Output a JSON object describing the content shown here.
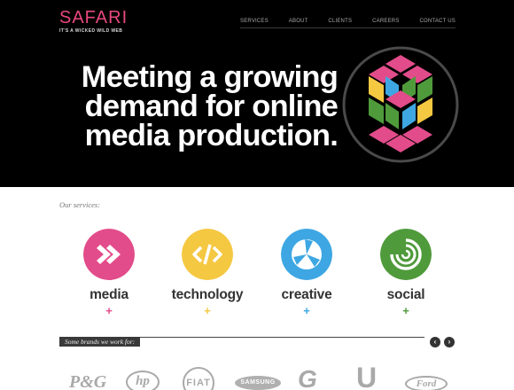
{
  "logo": {
    "word": "SAFARI",
    "tagline": "IT'S A WICKED WILD WEB"
  },
  "nav": {
    "items": [
      "SERVICES",
      "ABOUT",
      "CLIENTS",
      "CAREERS",
      "CONTACT US"
    ]
  },
  "hero": {
    "lines": [
      "Meeting a growing",
      "demand for online",
      "media production."
    ]
  },
  "services": {
    "title": "Our services:",
    "items": [
      {
        "label": "media",
        "plus": "+",
        "color": "#e24c8a"
      },
      {
        "label": "technology",
        "plus": "+",
        "color": "#f5c842"
      },
      {
        "label": "creative",
        "plus": "+",
        "color": "#3ea7e3"
      },
      {
        "label": "social",
        "plus": "+",
        "color": "#4f9a3b"
      }
    ]
  },
  "brands": {
    "title": "Some brands we work for:",
    "prev_icon": "‹",
    "next_icon": "›",
    "logos": [
      "P&G",
      "hp",
      "FIAT",
      "SAMSUNG",
      "G",
      "U",
      "Ford"
    ]
  },
  "colors": {
    "pink": "#e8487e",
    "black": "#000000",
    "yellow": "#f5c842",
    "blue": "#3ea7e3",
    "green": "#4f9a3b"
  }
}
